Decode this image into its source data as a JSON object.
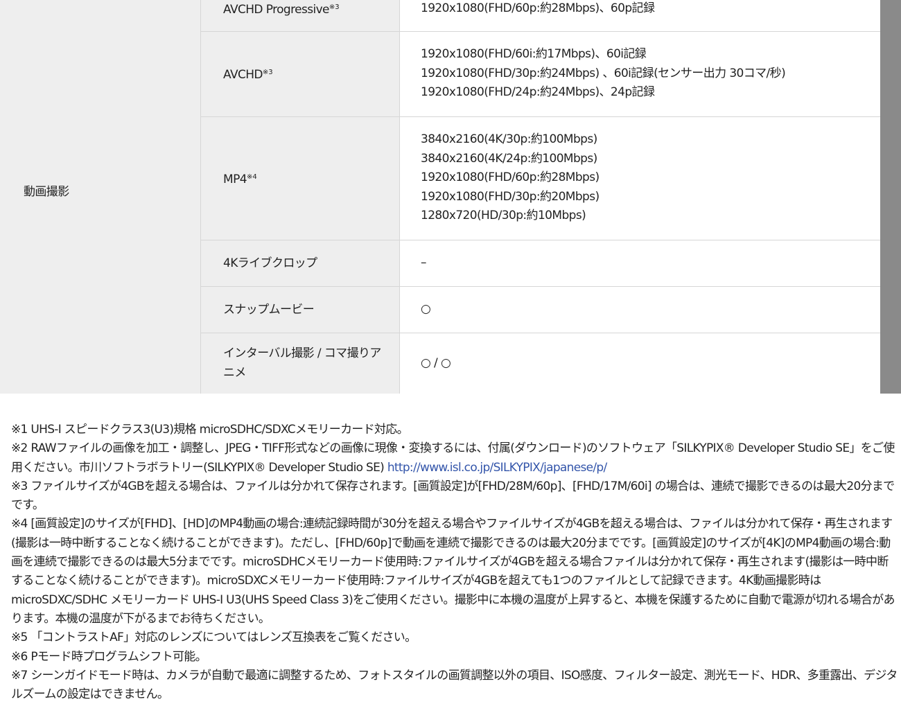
{
  "spec_table": {
    "category": "動画撮影",
    "rows": [
      {
        "label": "AVCHD Progressive",
        "sup": "※3",
        "values": [
          "1920x1080(FHD/60p:約28Mbps)、60p記録"
        ]
      },
      {
        "label": "AVCHD",
        "sup": "※3",
        "values": [
          "1920x1080(FHD/60i:約17Mbps)、60i記録",
          "1920x1080(FHD/30p:約24Mbps) 、60i記録(センサー出力 30コマ/秒)",
          "1920x1080(FHD/24p:約24Mbps)、24p記録"
        ]
      },
      {
        "label": "MP4",
        "sup": "※4",
        "values": [
          "3840x2160(4K/30p:約100Mbps)",
          "3840x2160(4K/24p:約100Mbps)",
          "1920x1080(FHD/60p:約28Mbps)",
          "1920x1080(FHD/30p:約20Mbps)",
          "1280x720(HD/30p:約10Mbps)"
        ]
      },
      {
        "label": "4Kライブクロップ",
        "sup": "",
        "values": [
          "–"
        ]
      },
      {
        "label": "スナップムービー",
        "sup": "",
        "values": [
          "○"
        ]
      },
      {
        "label": "インターバル撮影 / コマ撮りアニメ",
        "sup": "",
        "values": [
          "○ / ○"
        ]
      }
    ]
  },
  "notes": {
    "n1": "※1 UHS-I スピードクラス3(U3)規格 microSDHC/SDXCメモリーカード対応。",
    "n2_text": "※2 RAWファイルの画像を加工・調整し、JPEG・TIFF形式などの画像に現像・変換するには、付属(ダウンロード)のソフトウェア「SILKYPIX® Developer Studio SE」をご使用ください。市川ソフトラボラトリー(SILKYPIX® Developer Studio SE)",
    "n2_link": "http://www.isl.co.jp/SILKYPIX/japanese/p/",
    "n3": "※3 ファイルサイズが4GBを超える場合は、ファイルは分かれて保存されます。[画質設定]が[FHD/28M/60p]、[FHD/17M/60i] の場合は、連続で撮影できるのは最大20分までです。",
    "n4": "※4 [画質設定]のサイズが[FHD]、[HD]のMP4動画の場合:連続記録時間が30分を超える場合やファイルサイズが4GBを超える場合は、ファイルは分かれて保存・再生されます(撮影は一時中断することなく続けることができます)。ただし、[FHD/60p]で動画を連続で撮影できるのは最大20分までです。[画質設定]のサイズが[4K]のMP4動画の場合:動画を連続で撮影できるのは最大5分までです。microSDHCメモリーカード使用時:ファイルサイズが4GBを超える場合ファイルは分かれて保存・再生されます(撮影は一時中断することなく続けることができます)。microSDXCメモリーカード使用時:ファイルサイズが4GBを超えても1つのファイルとして記録できます。4K動画撮影時はmicroSDXC/SDHC メモリーカード UHS-I U3(UHS Speed Class 3)をご使用ください。撮影中に本機の温度が上昇すると、本機を保護するために自動で電源が切れる場合があります。本機の温度が下がるまでお待ちください。",
    "n5": "※5 「コントラストAF」対応のレンズについてはレンズ互換表をご覧ください。",
    "n6": "※6 Pモード時プログラムシフト可能。",
    "n7": "※7 シーンガイドモード時は、カメラが自動で最適に調整するため、フォトスタイルの画質調整以外の項目、ISO感度、フィルター設定、測光モード、HDR、多重露出、デジタルズームの設定はできません。"
  }
}
